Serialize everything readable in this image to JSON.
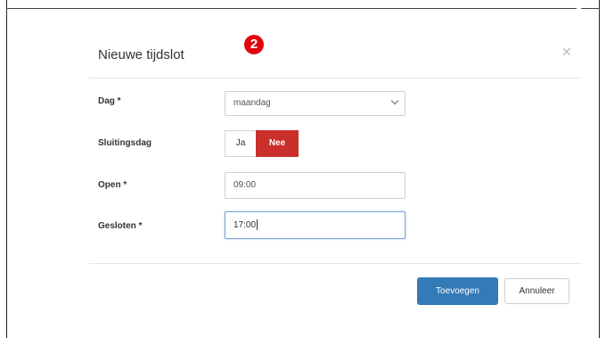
{
  "modal": {
    "title": "Nieuwe tijdslot",
    "step_badge": "2",
    "close_icon": "close-icon"
  },
  "form": {
    "day": {
      "label": "Dag *",
      "value": "maandag"
    },
    "closing_day": {
      "label": "Sluitingsdag",
      "options": [
        "Ja",
        "Nee"
      ],
      "selected": "Nee"
    },
    "open": {
      "label": "Open *",
      "value": "09:00"
    },
    "closed": {
      "label": "Gesloten *",
      "value": "17:00"
    }
  },
  "footer": {
    "add_label": "Toevoegen",
    "cancel_label": "Annuleer"
  },
  "colors": {
    "badge": "#e0060f",
    "selected_toggle": "#c9302c",
    "primary_button": "#337ab7"
  }
}
